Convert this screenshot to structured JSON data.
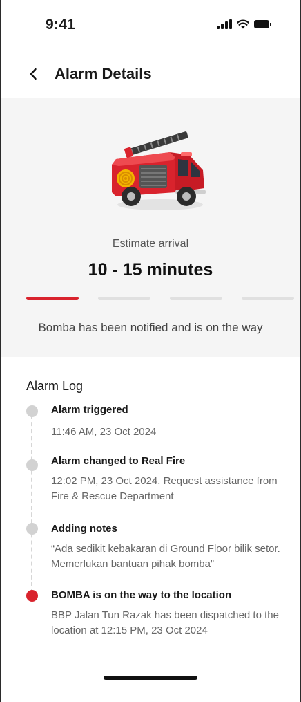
{
  "status_bar": {
    "time": "9:41"
  },
  "header": {
    "title": "Alarm Details"
  },
  "hero": {
    "eta_label": "Estimate arrival",
    "eta_value": "10 - 15 minutes",
    "progress": {
      "total_steps": 4,
      "current_step": 1
    },
    "status_text": "Bomba has been notified and is on the way"
  },
  "alarm_log": {
    "title": "Alarm Log",
    "items": [
      {
        "title": "Alarm triggered",
        "detail": "11:46 AM, 23 Oct 2024",
        "active": false
      },
      {
        "title": "Alarm changed to Real Fire",
        "detail": "12:02 PM, 23 Oct 2024. Request assistance from Fire & Rescue Department",
        "active": false
      },
      {
        "title": "Adding notes",
        "detail": "“Ada sedikit kebakaran di Ground Floor bilik setor. Memerlukan bantuan pihak bomba”",
        "active": false
      },
      {
        "title": "BOMBA is on the way to the location",
        "detail": "BBP Jalan Tun Razak has been dispatched to the location at 12:15 PM, 23 Oct 2024",
        "active": true
      }
    ]
  },
  "colors": {
    "accent": "#d9232d",
    "inactive_dot": "#d2d2d2",
    "panel_bg": "#f5f5f5"
  }
}
